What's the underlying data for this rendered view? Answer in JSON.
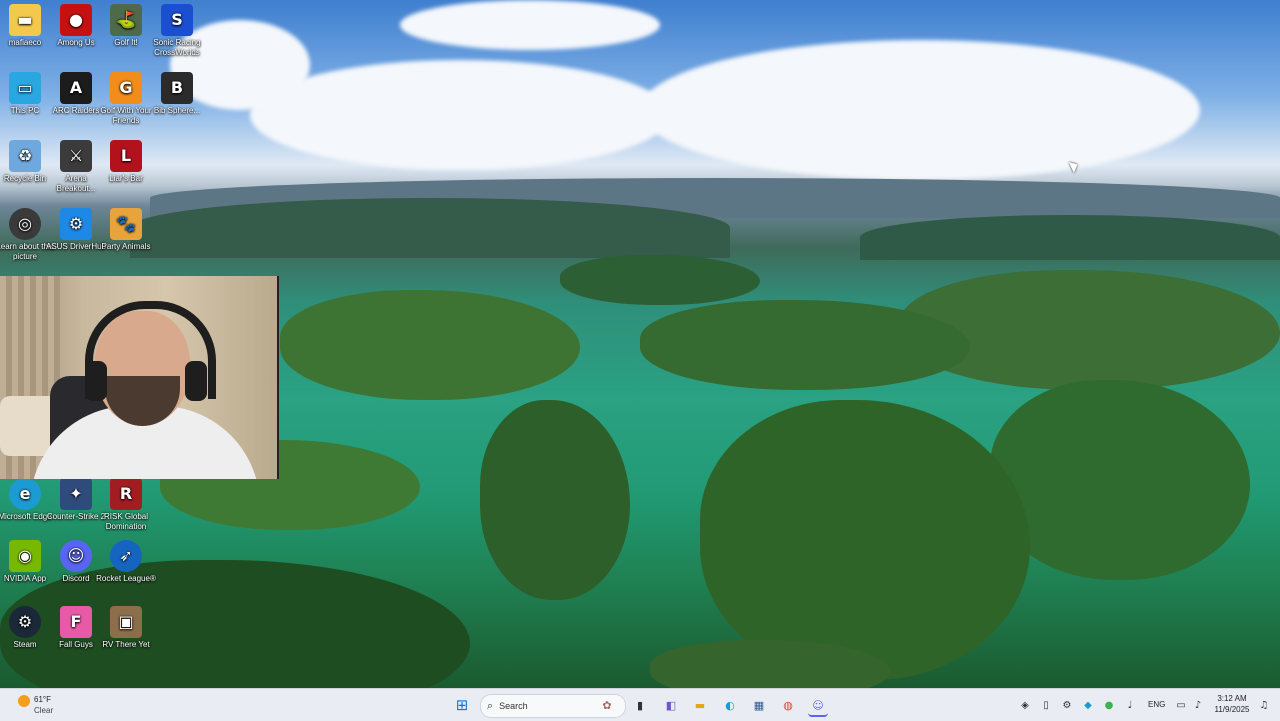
{
  "desktop": {
    "icons": [
      {
        "label": "mafiaeco",
        "icon": "folder-icon",
        "color": "#f2c94c"
      },
      {
        "label": "Among Us",
        "icon": "among-us-icon",
        "color": "#c51111"
      },
      {
        "label": "Golf It!",
        "icon": "golf-it-icon",
        "color": "#4d6b4a"
      },
      {
        "label": "Sonic Racing CrossWorlds",
        "icon": "sonic-icon",
        "color": "#1b4fd1"
      },
      {
        "label": "This PC",
        "icon": "monitor-icon",
        "color": "#2aa6e0"
      },
      {
        "label": "ARC Raiders",
        "icon": "arc-raiders-icon",
        "color": "#1c1c1c"
      },
      {
        "label": "Golf With Your Friends",
        "icon": "golf-friends-icon",
        "color": "#f28c1b"
      },
      {
        "label": "Bib Sphere...",
        "icon": "game-icon",
        "color": "#2b2b2b"
      },
      {
        "label": "Recycle Bin",
        "icon": "recycle-bin-icon",
        "color": "#6fa8dc"
      },
      {
        "label": "Arena Breakout...",
        "icon": "arena-breakout-icon",
        "color": "#3b3b3b"
      },
      {
        "label": "Liar's Bar",
        "icon": "liars-bar-icon",
        "color": "#b3121d"
      },
      {
        "label": "Learn about this picture",
        "icon": "learn-picture-icon",
        "color": "#3a3a3a"
      },
      {
        "label": "ASUS DriverHub",
        "icon": "asus-icon",
        "color": "#1e88e5"
      },
      {
        "label": "Party Animals",
        "icon": "party-animals-icon",
        "color": "#e8a33d"
      },
      {
        "label": "Microsoft Edge",
        "icon": "edge-icon",
        "color": "#1b9bd1"
      },
      {
        "label": "Counter-Strike 2",
        "icon": "counter-strike-icon",
        "color": "#2f4b7c"
      },
      {
        "label": "RISK Global Domination",
        "icon": "risk-icon",
        "color": "#a11d22"
      },
      {
        "label": "NVIDIA App",
        "icon": "nvidia-icon",
        "color": "#76b900"
      },
      {
        "label": "Discord",
        "icon": "discord-icon",
        "color": "#5865f2"
      },
      {
        "label": "Rocket League®",
        "icon": "rocket-league-icon",
        "color": "#1565c0"
      },
      {
        "label": "Steam",
        "icon": "steam-icon",
        "color": "#1b2838"
      },
      {
        "label": "Fall Guys",
        "icon": "fall-guys-icon",
        "color": "#e85aa8"
      },
      {
        "label": "RV There Yet",
        "icon": "rv-there-yet-icon",
        "color": "#8d6e4a"
      }
    ]
  },
  "taskbar": {
    "weather": {
      "temp": "61°F",
      "condition": "Clear"
    },
    "search_placeholder": "Search",
    "apps": [
      {
        "name": "start-button",
        "icon": "windows-icon",
        "color": "#0a74da"
      },
      {
        "name": "taskbar-file-explorer",
        "icon": "file-explorer-icon",
        "color": "#f2c94c"
      },
      {
        "name": "taskbar-edge",
        "icon": "edge-icon",
        "color": "#1b9bd1"
      },
      {
        "name": "taskbar-store",
        "icon": "store-icon",
        "color": "#2b5797"
      },
      {
        "name": "taskbar-chrome",
        "icon": "chrome-icon",
        "color": "#db4437"
      },
      {
        "name": "taskbar-discord",
        "icon": "discord-icon",
        "color": "#5865f2"
      }
    ],
    "language": "ENG",
    "time": "3:12 AM",
    "date": "11/9/2025"
  }
}
